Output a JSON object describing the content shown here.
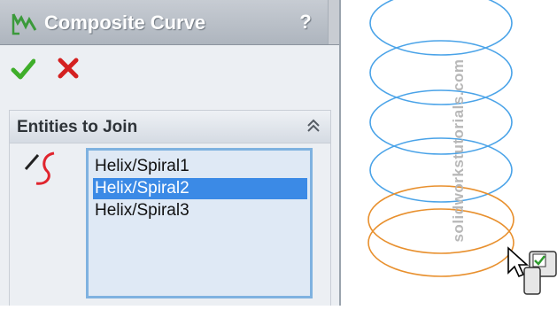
{
  "title": "Composite Curve",
  "help_label": "?",
  "section": {
    "title": "Entities to Join"
  },
  "entities": [
    {
      "label": "Helix/Spiral1",
      "selected": false
    },
    {
      "label": "Helix/Spiral2",
      "selected": true
    },
    {
      "label": "Helix/Spiral3",
      "selected": false
    }
  ],
  "watermark": "solidworkstutorials.com",
  "icons": {
    "title": "composite-curve-icon",
    "ok": "green-check-icon",
    "cancel": "red-x-icon",
    "collapse": "double-chevron-up-icon",
    "entity": "curve-selection-icon",
    "cursor": "arrow-cursor-icon",
    "cursor_badge": "selection-filter-icon"
  },
  "colors": {
    "selected_helix": "#4aa3e8",
    "unselected_helix": "#e8902e",
    "selection_highlight": "#3b8ae6",
    "listbox_border": "#7fb2e0"
  }
}
